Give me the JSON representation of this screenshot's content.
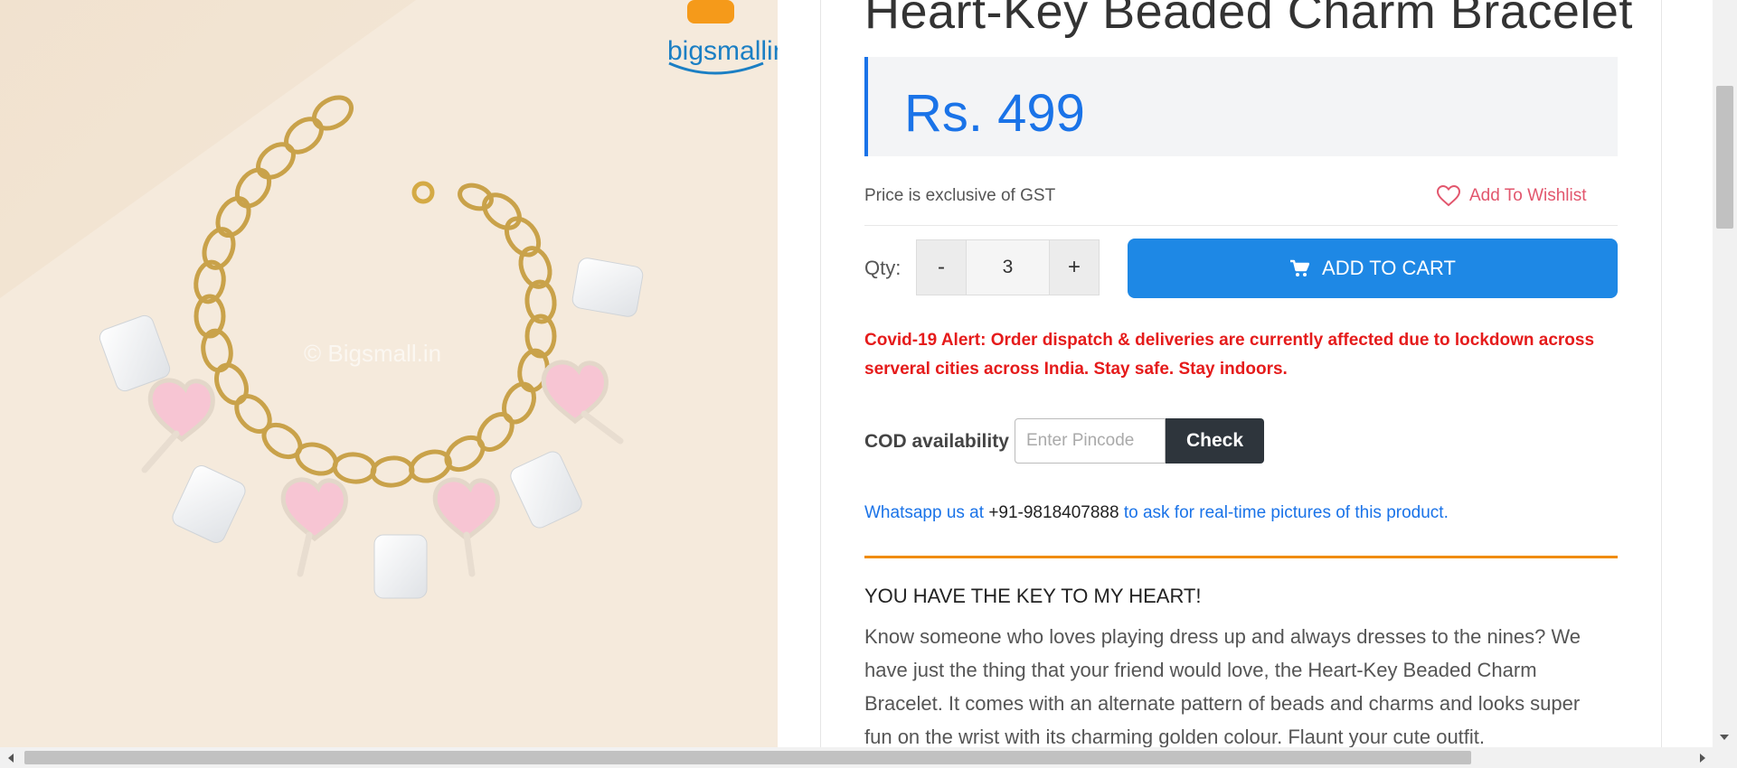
{
  "product": {
    "title": "Heart-Key Beaded Charm Bracelet",
    "price": "Rs. 499",
    "price_note": "Price is exclusive of GST",
    "image_watermark": "© Bigsmall.in",
    "brand_logo_text": "bigsmallin"
  },
  "wishlist": {
    "label": "Add To Wishlist",
    "icon": "heart-outline-icon"
  },
  "quantity": {
    "label": "Qty:",
    "decrement": "-",
    "value": "3",
    "increment": "+"
  },
  "cart": {
    "label": "ADD TO CART",
    "icon": "cart-icon"
  },
  "alert": {
    "text": "Covid-19 Alert: Order dispatch & deliveries are currently affected due to lockdown across serveral cities across India. Stay safe. Stay indoors."
  },
  "cod": {
    "label": "COD availability",
    "placeholder": "Enter Pincode",
    "button": "Check"
  },
  "whatsapp": {
    "prefix": "Whatsapp us at",
    "phone": "+91-9818407888",
    "suffix": "to ask for real-time pictures of this product."
  },
  "description": {
    "heading": "YOU HAVE THE KEY TO MY HEART!",
    "body": "Know someone who loves playing dress up and always dresses to the nines? We have just the thing that your friend would love, the Heart-Key Beaded Charm Bracelet. It comes with an alternate pattern of beads and charms and looks super fun on the wrist with its charming golden colour. Flaunt your cute outfit."
  },
  "colors": {
    "accent": "#1a73e8",
    "cart_button": "#1e88e5",
    "alert": "#e51b1b",
    "wishlist": "#e2566d",
    "divider": "#f08c00",
    "check_button": "#2e353c"
  }
}
